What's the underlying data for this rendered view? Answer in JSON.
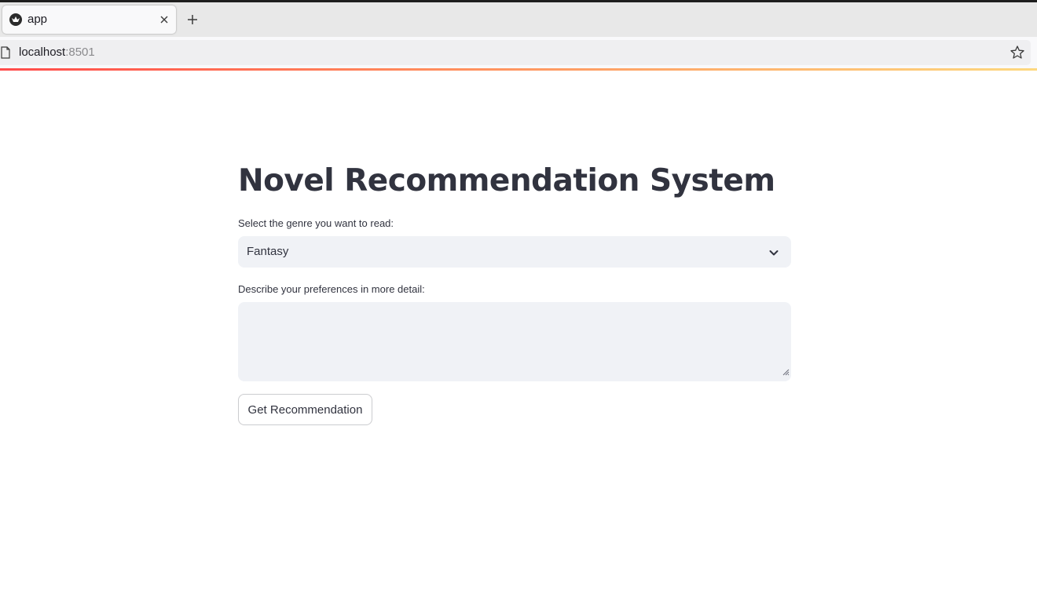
{
  "browser": {
    "tab_title": "app",
    "url_host": "localhost",
    "url_port": ":8501"
  },
  "main": {
    "title": "Novel Recommendation System",
    "genre_label": "Select the genre you want to read:",
    "genre_value": "Fantasy",
    "details_label": "Describe your preferences in more detail:",
    "details_value": "",
    "button_label": "Get Recommendation"
  },
  "colors": {
    "text": "#31333f",
    "input_bg": "#f0f2f6",
    "accent_gradient_start": "#ff4b4b",
    "accent_gradient_end": "#fdd87f"
  }
}
